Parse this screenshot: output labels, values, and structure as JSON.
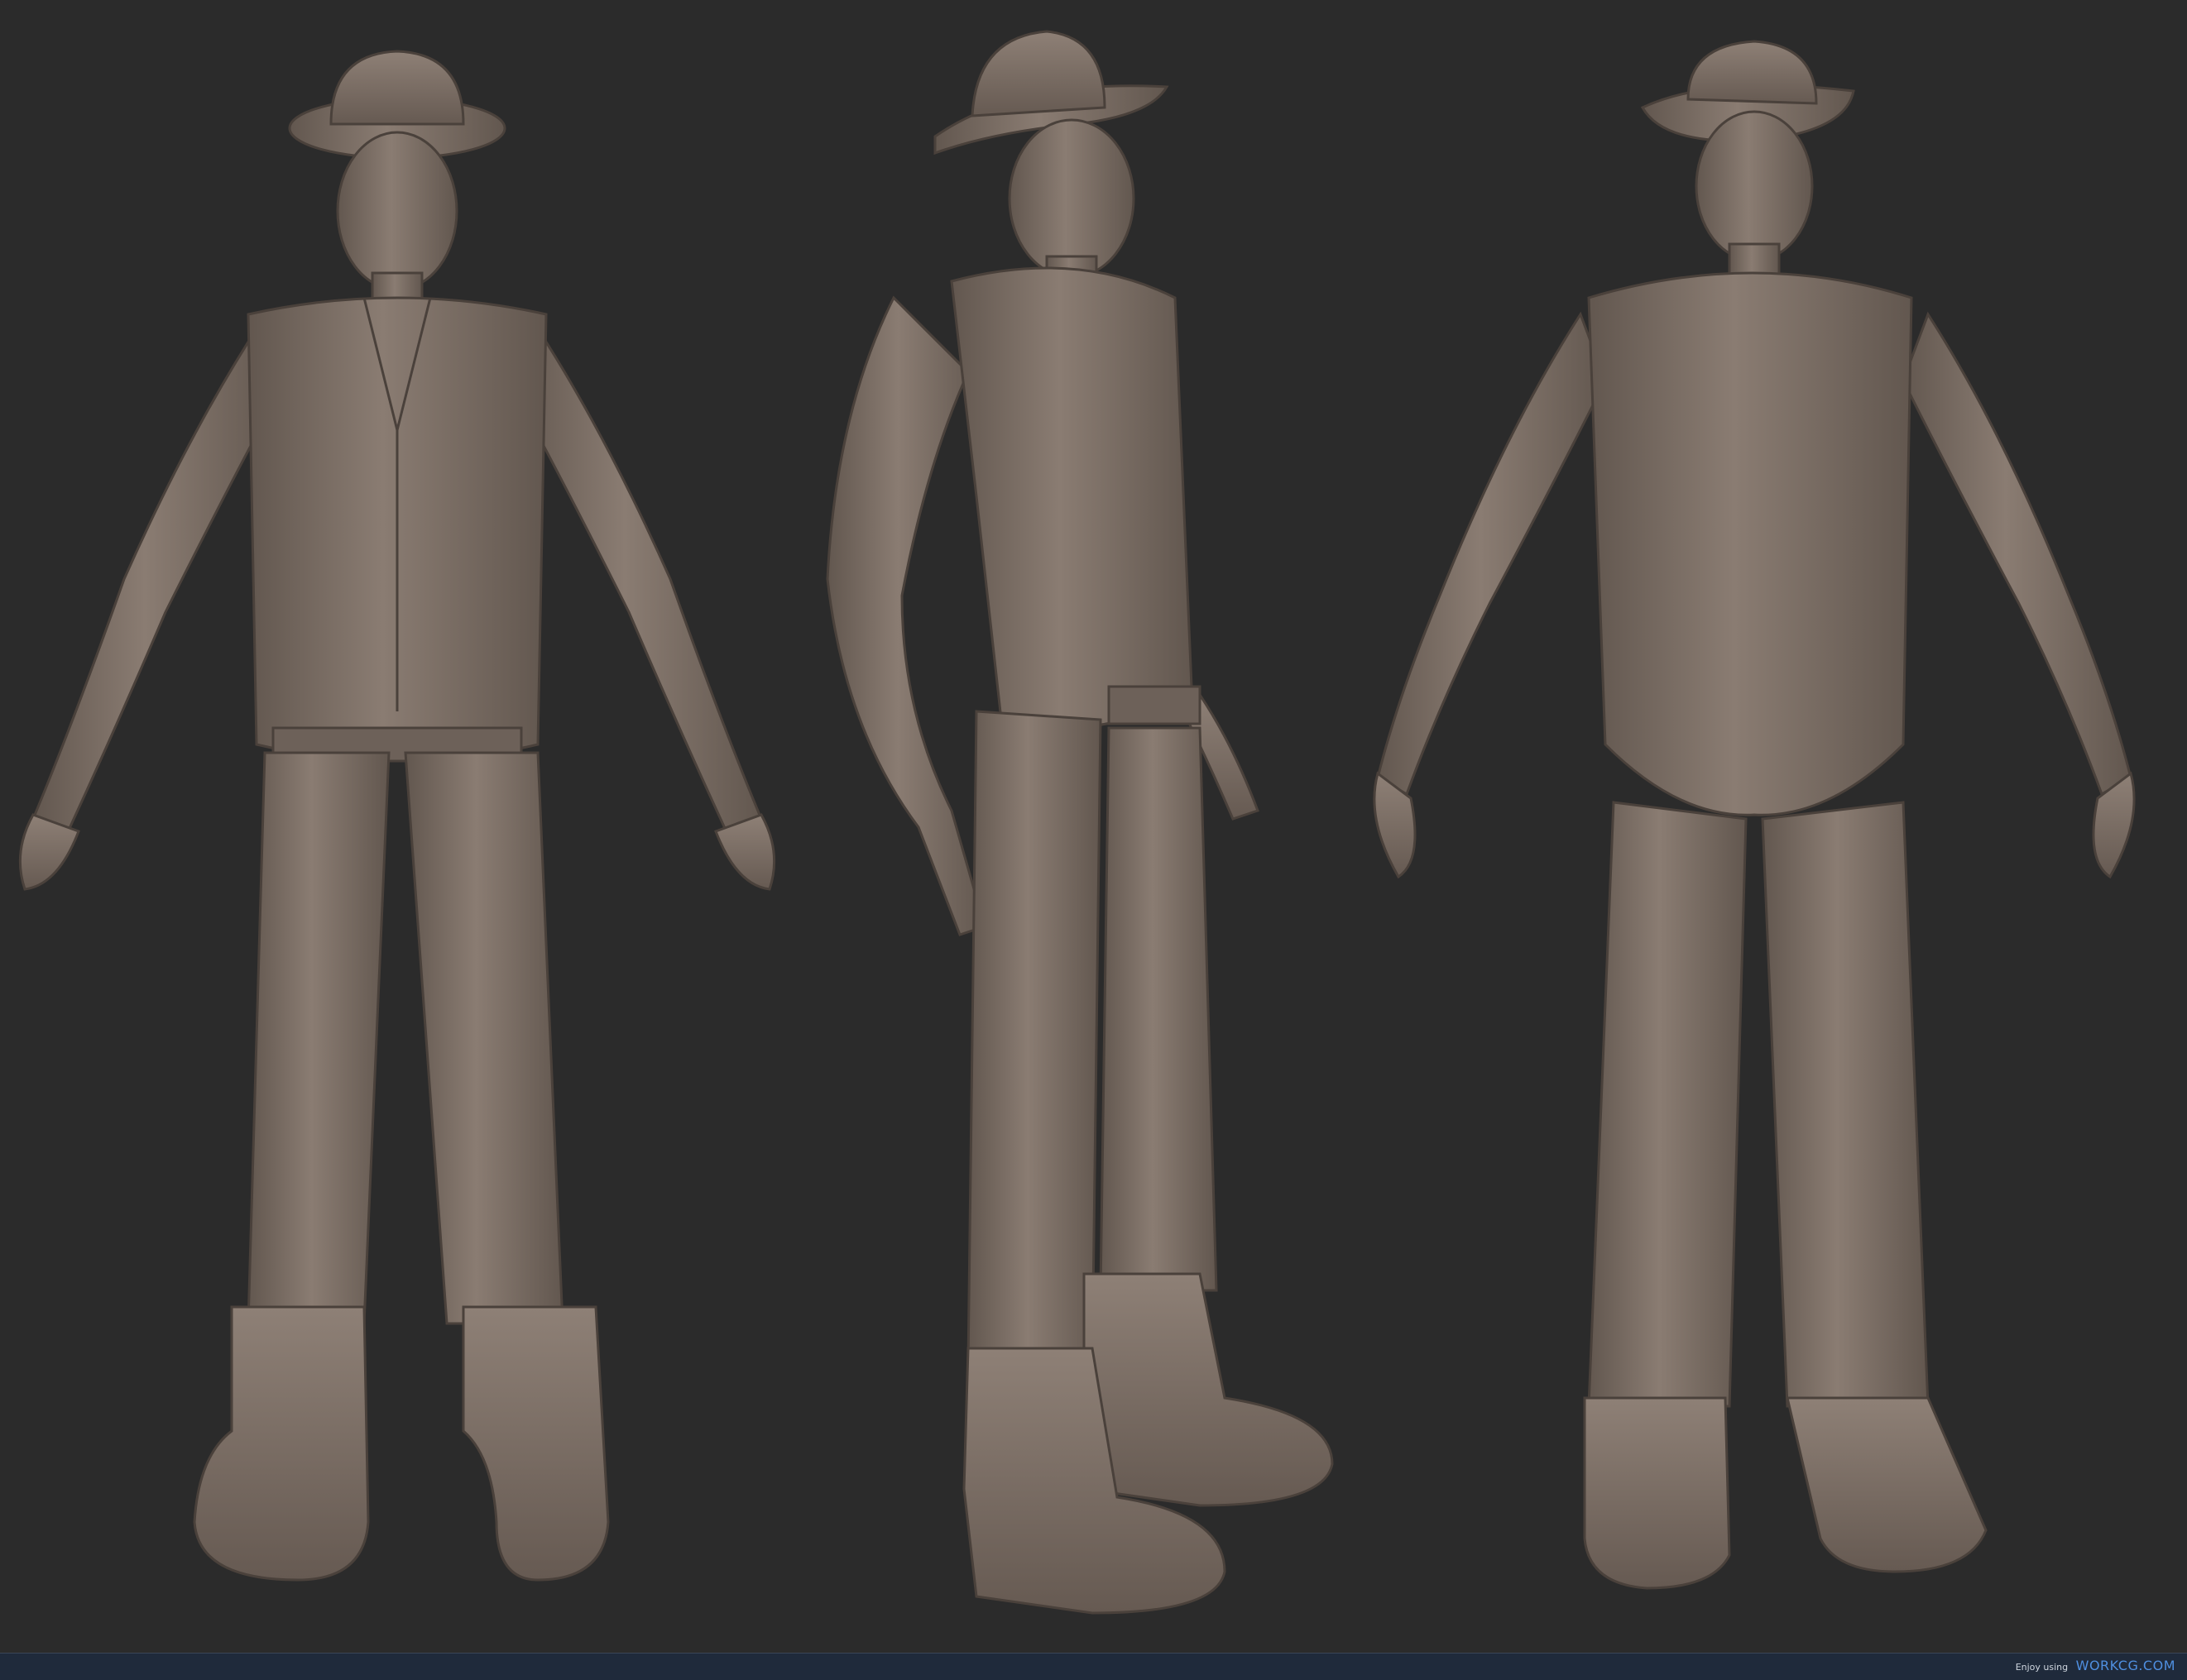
{
  "scene": {
    "views": [
      {
        "name": "front"
      },
      {
        "name": "side"
      },
      {
        "name": "back"
      }
    ],
    "colors": {
      "background": "#2b2b2b",
      "clay": "#7c6f66",
      "clay_dark": "#5e534b",
      "clay_light": "#9a8b80",
      "footer": "#1f2a3b",
      "brand": "#4f8fe0"
    }
  },
  "footer": {
    "enjoy_text": "Enjoy using",
    "brand_text": "WORKCG.COM"
  }
}
